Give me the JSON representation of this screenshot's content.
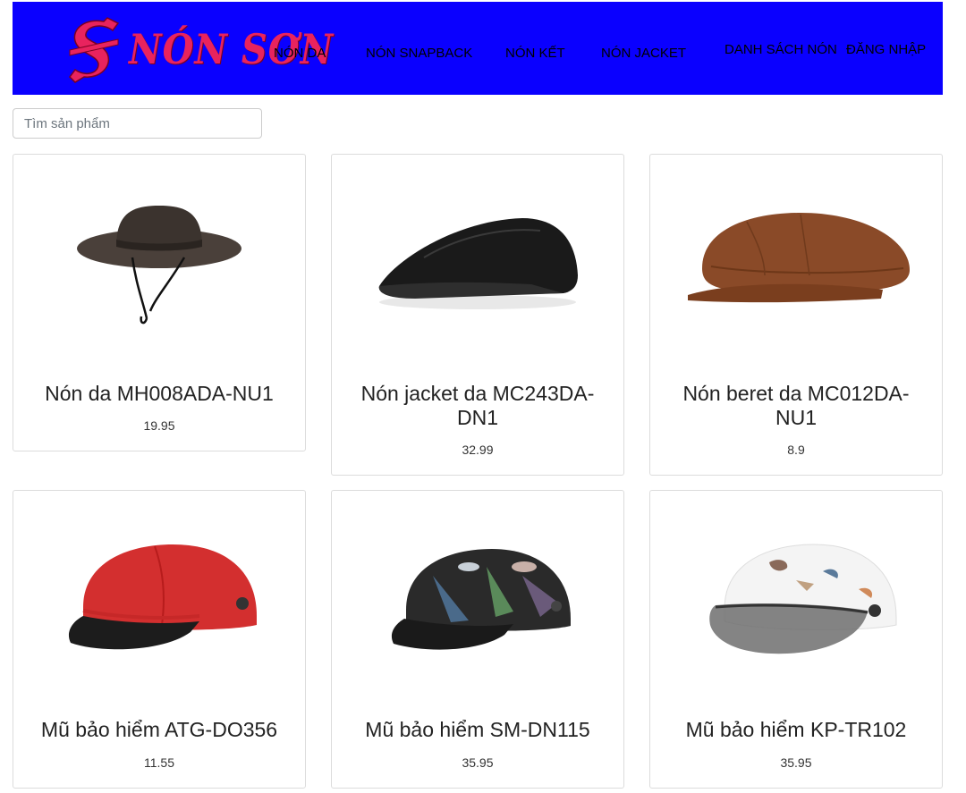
{
  "brand": {
    "name": "NÓN SƠN"
  },
  "nav": {
    "items": [
      "NÓN DA",
      "NÓN SNAPBACK",
      "NÓN KẾT",
      "NÓN JACKET",
      "DANH SÁCH NÓN",
      "ĐĂNG NHẬP"
    ]
  },
  "search": {
    "placeholder": "Tìm sản phẩm",
    "value": ""
  },
  "colors": {
    "navbar": "#0a00ff",
    "brand": "#e8235e"
  },
  "products": [
    {
      "name": "Nón da MH008ADA-NU1",
      "price": "19.95",
      "icon": "bucket-hat-image"
    },
    {
      "name": "Nón jacket da MC243DA-DN1",
      "price": "32.99",
      "icon": "flat-cap-image"
    },
    {
      "name": "Nón beret da MC012DA-NU1",
      "price": "8.9",
      "icon": "beret-cap-image"
    },
    {
      "name": "Mũ bảo hiểm ATG-DO356",
      "price": "11.55",
      "icon": "red-helmet-image"
    },
    {
      "name": "Mũ bảo hiểm SM-DN115",
      "price": "35.95",
      "icon": "patterned-helmet-image"
    },
    {
      "name": "Mũ bảo hiểm KP-TR102",
      "price": "35.95",
      "icon": "visor-helmet-image"
    }
  ]
}
